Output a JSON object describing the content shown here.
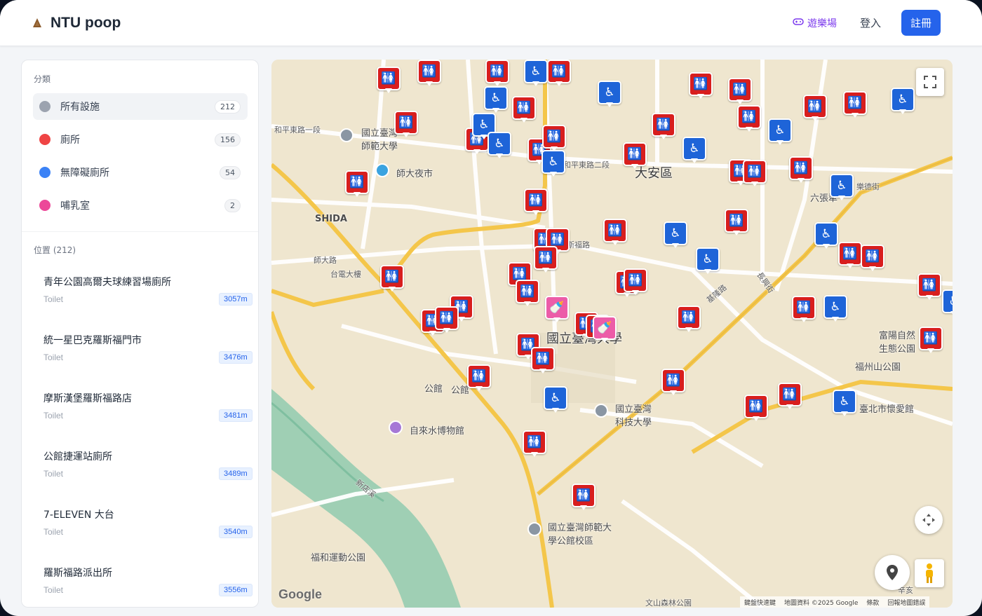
{
  "app": {
    "title": "NTU poop"
  },
  "nav": {
    "playground": "遊樂場",
    "login": "登入",
    "register": "註冊"
  },
  "categories": {
    "heading": "分類",
    "items": [
      {
        "label": "所有設施",
        "count": "212",
        "color": "#9ca3af"
      },
      {
        "label": "廁所",
        "count": "156",
        "color": "#ef4444"
      },
      {
        "label": "無障礙廁所",
        "count": "54",
        "color": "#3b82f6"
      },
      {
        "label": "哺乳室",
        "count": "2",
        "color": "#ec4899"
      }
    ]
  },
  "locations": {
    "heading": "位置 (212)",
    "items": [
      {
        "name": "青年公園高爾夫球練習場廁所",
        "type": "Toilet",
        "distance": "3057m"
      },
      {
        "name": "統一星巴克羅斯福門市",
        "type": "Toilet",
        "distance": "3476m"
      },
      {
        "name": "摩斯漢堡羅斯福路店",
        "type": "Toilet",
        "distance": "3481m"
      },
      {
        "name": "公館捷運站廁所",
        "type": "Toilet",
        "distance": "3489m"
      },
      {
        "name": "7-ELEVEN 大台",
        "type": "Toilet",
        "distance": "3540m"
      },
      {
        "name": "羅斯福路派出所",
        "type": "Toilet",
        "distance": "3556m"
      }
    ]
  },
  "map": {
    "labels": {
      "daan": "大安區",
      "shida": "SHIDA",
      "ntnu": "國立臺灣師範大學",
      "shida_market": "師大夜市",
      "ntu": "國立臺灣大學",
      "ntust": "國立臺灣科技大學",
      "water_museum": "自來水博物館",
      "gongguan1": "公館",
      "gongguan2": "公館",
      "fuhe_park": "福和運動公園",
      "ntnu_gongguan": "國立臺灣師範大學公館校區",
      "fuzhou_park": "福州山公園",
      "fuyang_park": "富陽自然生態公園",
      "xindian_river": "新店溪",
      "heping_rd1": "和平東路一段",
      "heping_rd2": "和平東路二段",
      "roosevelt_rd": "羅斯福路",
      "taipower": "台電大樓",
      "shida_rd": "師大路",
      "keelung_rd": "基隆路",
      "changxing_st": "長興街",
      "liuzhangli": "六張犁",
      "lede_st": "樂德街",
      "taibei_huaai": "臺北市懷愛館",
      "wenshan_forest": "文山森林公園",
      "xinhai": "辛亥"
    },
    "attribution": {
      "shortcuts": "鍵盤快速鍵",
      "data": "地圖資料 ©2025 Google",
      "terms": "條款",
      "report": "回報地圖錯誤"
    },
    "brand": "Google",
    "pin_colors": {
      "toilet": "#d81e1e",
      "accessible": "#1e64d8",
      "nursing": "#ec5ca8"
    }
  }
}
